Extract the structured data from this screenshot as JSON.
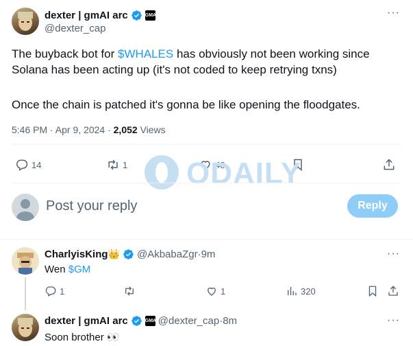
{
  "main_tweet": {
    "author_name": "dexter | gmAI arc",
    "author_handle": "@dexter_cap",
    "affiliate_badge": "GMAI",
    "body_prefix": "The buyback bot for ",
    "body_cashtag": "$WHALES",
    "body_suffix": " has obviously not been working since Solana has been acting up (it's not coded to keep retrying txns)",
    "body_para2": "Once the chain is patched it's gonna be like opening the floodgates.",
    "time": "5:46 PM · Apr 9, 2024 · ",
    "views_count": "2,052",
    "views_label": " Views",
    "actions": {
      "replies": "14",
      "retweets": "1",
      "likes": "40"
    }
  },
  "composer": {
    "placeholder": "Post your reply",
    "button_label": "Reply"
  },
  "watermark": {
    "text": "ODAILY"
  },
  "reply1": {
    "author_name": "CharlyisKing",
    "author_emoji": "👑",
    "author_handle": "@AkbabaZgr",
    "separator": " · ",
    "time": "9m",
    "body_prefix": "Wen ",
    "body_cashtag": "$GM",
    "actions": {
      "replies": "1",
      "retweets": "",
      "likes": "1",
      "views": "320"
    }
  },
  "reply2": {
    "author_name": "dexter | gmAI arc",
    "author_handle": "@dexter_cap",
    "separator": " · ",
    "time": "8m",
    "body": "Soon brother 👀"
  },
  "colors": {
    "accent": "#1d9bf0",
    "muted": "#536471",
    "divider": "#eff3f4",
    "reply_button": "#8ecdf8"
  }
}
